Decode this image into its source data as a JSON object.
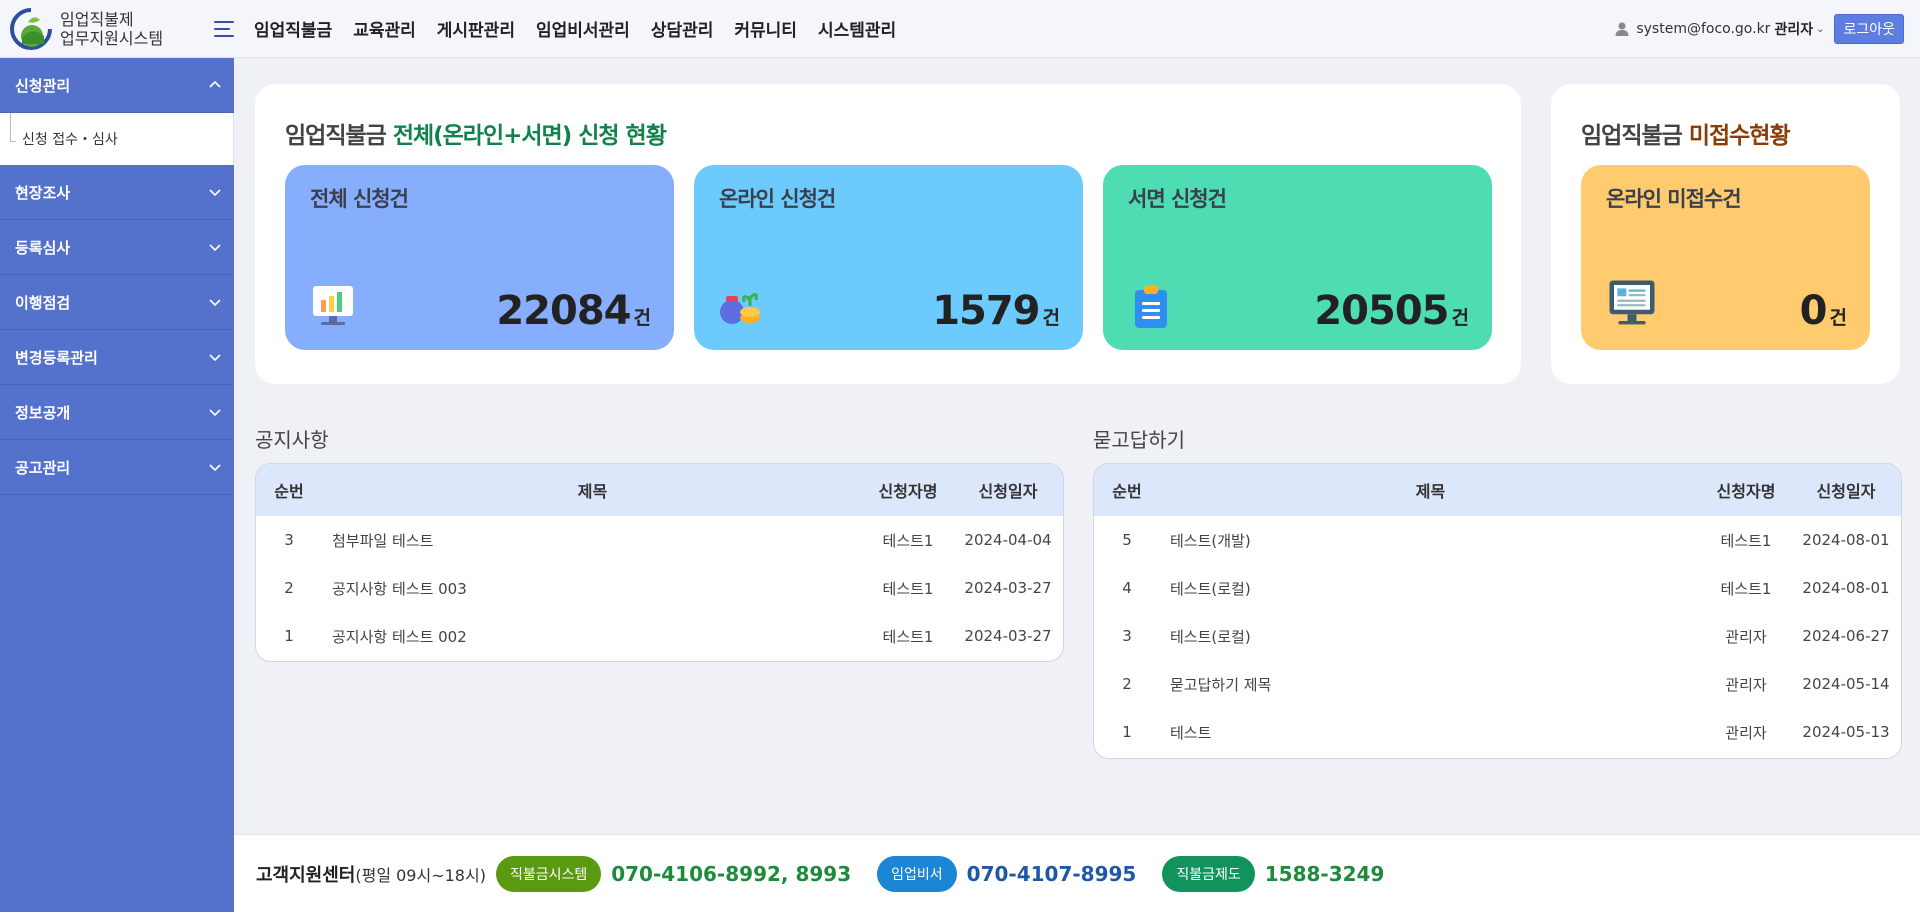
{
  "header": {
    "logo_line1": "임업직불제",
    "logo_line2": "업무지원시스템",
    "nav": [
      "임업직불금",
      "교육관리",
      "게시판관리",
      "임업비서관리",
      "상담관리",
      "커뮤니티",
      "시스템관리"
    ],
    "user_email": "system@foco.go.kr",
    "user_role": "관리자",
    "logout_label": "로그아웃"
  },
  "sidebar": {
    "items": [
      {
        "label": "신청관리",
        "expanded": true
      },
      {
        "label": "현장조사",
        "expanded": false
      },
      {
        "label": "등록심사",
        "expanded": false
      },
      {
        "label": "이행점검",
        "expanded": false
      },
      {
        "label": "변경등록관리",
        "expanded": false
      },
      {
        "label": "정보공개",
        "expanded": false
      },
      {
        "label": "공고관리",
        "expanded": false
      }
    ],
    "sub_item": "신청 접수・심사"
  },
  "stats": {
    "total_title_prefix": "임업직불금 ",
    "total_title_highlight": "전체(온라인+서면) 신청 현황",
    "unreceived_title_prefix": "임업직불금 ",
    "unreceived_title_highlight": "미접수현황",
    "unit": "건",
    "cards": [
      {
        "label": "전체 신청건",
        "value": "22084",
        "color": "#87aefc",
        "icon": "monitor-chart-icon"
      },
      {
        "label": "온라인 신청건",
        "value": "1579",
        "color": "#6ccbfc",
        "icon": "coins-sprout-icon"
      },
      {
        "label": "서면 신청건",
        "value": "20505",
        "color": "#4edcb2",
        "icon": "clipboard-icon"
      }
    ],
    "unreceived_card": {
      "label": "온라인 미접수건",
      "value": "0",
      "color": "#ffcb6e",
      "icon": "computer-document-icon"
    }
  },
  "notice": {
    "title": "공지사항",
    "headers": {
      "no": "순번",
      "title": "제목",
      "name": "신청자명",
      "date": "신청일자"
    },
    "rows": [
      {
        "no": "3",
        "title": "첨부파일 테스트",
        "name": "테스트1",
        "date": "2024-04-04"
      },
      {
        "no": "2",
        "title": "공지사항 테스트 003",
        "name": "테스트1",
        "date": "2024-03-27"
      },
      {
        "no": "1",
        "title": "공지사항 테스트 002",
        "name": "테스트1",
        "date": "2024-03-27"
      }
    ]
  },
  "qna": {
    "title": "묻고답하기",
    "headers": {
      "no": "순번",
      "title": "제목",
      "name": "신청자명",
      "date": "신청일자"
    },
    "rows": [
      {
        "no": "5",
        "title": "테스트(개발)",
        "name": "테스트1",
        "date": "2024-08-01"
      },
      {
        "no": "4",
        "title": "테스트(로컬)",
        "name": "테스트1",
        "date": "2024-08-01"
      },
      {
        "no": "3",
        "title": "테스트(로컬)",
        "name": "관리자",
        "date": "2024-06-27"
      },
      {
        "no": "2",
        "title": "묻고답하기 제목",
        "name": "관리자",
        "date": "2024-05-14"
      },
      {
        "no": "1",
        "title": "테스트",
        "name": "관리자",
        "date": "2024-05-13"
      }
    ]
  },
  "footer": {
    "center_label": "고객지원센터",
    "hours": "(평일 09시~18시)",
    "contacts": [
      {
        "label": "직불금시스템",
        "phone": "070-4106-8992, 8993",
        "pill_color": "#5a9a10",
        "phone_color": "#1e8a3c"
      },
      {
        "label": "임업비서",
        "phone": "070-4107-8995",
        "pill_color": "#1a86d4",
        "phone_color": "#1e57a8"
      },
      {
        "label": "직불금제도",
        "phone": "1588-3249",
        "pill_color": "#12935e",
        "phone_color": "#1e8a3c"
      }
    ]
  }
}
